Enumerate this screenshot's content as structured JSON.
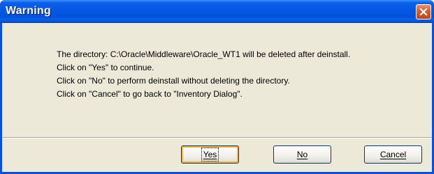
{
  "window": {
    "title": "Warning"
  },
  "message": {
    "lines": [
      "The directory: C:\\Oracle\\Middleware\\Oracle_WT1 will be deleted after deinstall.",
      "Click on \"Yes\" to continue.",
      "Click on \"No\" to perform deinstall without deleting the directory.",
      "Click on \"Cancel\" to go back to \"Inventory Dialog\"."
    ]
  },
  "buttons": {
    "yes": "Yes",
    "no": "No",
    "cancel": "Cancel"
  },
  "icons": {
    "close": "close-icon"
  },
  "colors": {
    "titlebar": "#0857e3",
    "client": "#ece9d8",
    "close_button": "#d65b2e",
    "default_button_focus": "#f8b33a"
  }
}
